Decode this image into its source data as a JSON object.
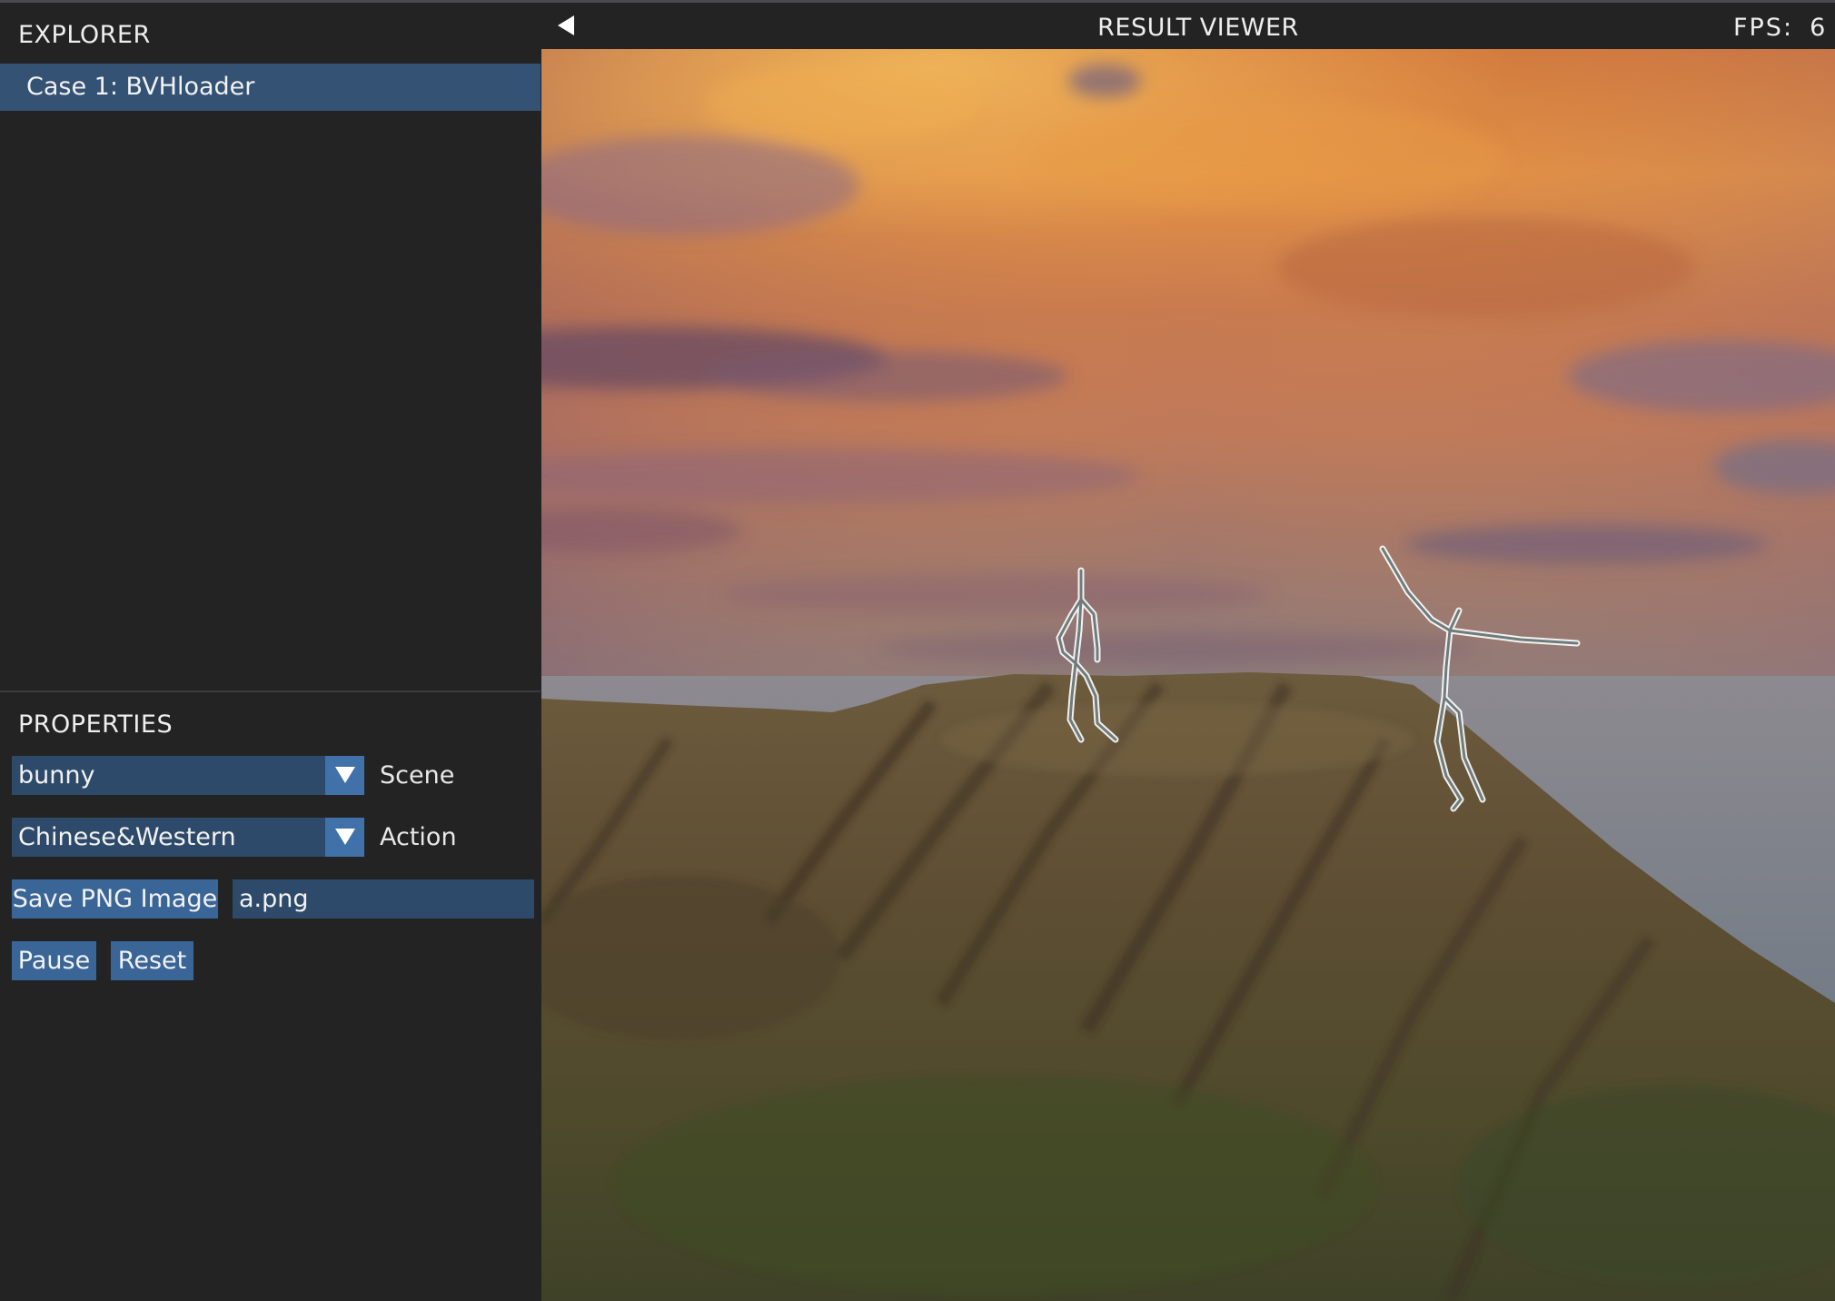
{
  "explorer": {
    "title": "EXPLORER",
    "items": [
      {
        "label": "Case 1: BVHloader",
        "selected": true
      }
    ]
  },
  "properties": {
    "title": "PROPERTIES",
    "scene": {
      "value": "bunny",
      "label": "Scene"
    },
    "action": {
      "value": "Chinese&Western",
      "label": "Action"
    },
    "save_button": "Save PNG Image",
    "filename": "a.png",
    "pause_button": "Pause",
    "reset_button": "Reset"
  },
  "viewer": {
    "title": "RESULT VIEWER",
    "fps_label": "FPS:",
    "fps_value": "6"
  },
  "colors": {
    "panel_bg": "#232324",
    "selection": "#345274",
    "button": "#3a6597",
    "field": "#2e4a6b",
    "sky_orange": "#d9883f",
    "terrain": "#5b4a30"
  },
  "icons": {
    "back": "back-triangle-icon",
    "dropdown": "dropdown-arrow-icon"
  }
}
